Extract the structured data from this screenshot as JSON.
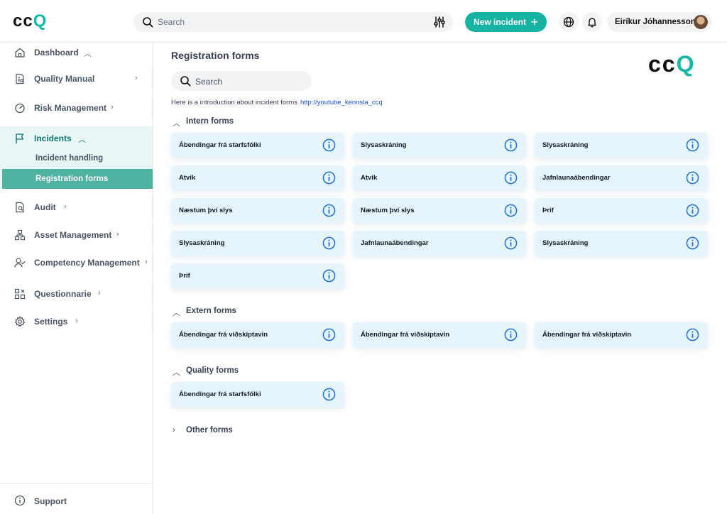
{
  "topbar": {
    "search_placeholder": "Search",
    "new_incident_label": "New incident",
    "user_name": "Eiríkur Jóhannesson"
  },
  "sidebar": {
    "items": [
      {
        "label": "Dashboard"
      },
      {
        "label": "Quality Manual"
      },
      {
        "label": "Risk Management"
      },
      {
        "label": "Incidents"
      },
      {
        "label": "Audit"
      },
      {
        "label": "Asset Management"
      },
      {
        "label": "Competency Management"
      },
      {
        "label": "Questionnarie"
      },
      {
        "label": "Settings"
      }
    ],
    "sub_items": [
      {
        "label": "Incident handling"
      },
      {
        "label": "Registration forms"
      }
    ],
    "support_label": "Support"
  },
  "main": {
    "title": "Registration forms",
    "search_placeholder": "Search",
    "intro_text": "Here is a introduction about incident forms",
    "intro_link": "http://youtube_kennsla_ccq",
    "sections": [
      {
        "label": "Intern forms",
        "forms": [
          "Ábendingar frá starfsfólki",
          "Slysaskráning",
          "Slysaskráning",
          "Atvik",
          "Atvik",
          "Jafnlaunaábendingar",
          "Næstum því slys",
          "Næstum því slys",
          "Þrif",
          "Slysaskráning",
          "Jafnlaunaábendingar",
          "Slysaskráning",
          "Þrif"
        ]
      },
      {
        "label": "Extern forms",
        "forms": [
          "Ábendingar frá viðskiptavin",
          "Ábendingar frá viðskiptavin",
          "Ábendingar frá viðskiptavin"
        ]
      },
      {
        "label": "Quality forms",
        "forms": [
          "Ábendingar frá starfsfólki"
        ]
      },
      {
        "label": "Other forms",
        "forms": []
      }
    ]
  },
  "colors": {
    "accent": "#16b3a3",
    "active_nav": "#4fb3a2",
    "card_bg": "#e6f4fb",
    "info_icon": "#1e6fd9"
  },
  "icons": [
    "search-icon",
    "filter-icon",
    "plus-icon",
    "globe-icon",
    "bell-icon",
    "home-icon",
    "document-icon",
    "gauge-icon",
    "flag-icon",
    "audit-icon",
    "asset-icon",
    "competency-icon",
    "questionnaire-icon",
    "gear-icon",
    "info-icon",
    "chevron-icon"
  ]
}
